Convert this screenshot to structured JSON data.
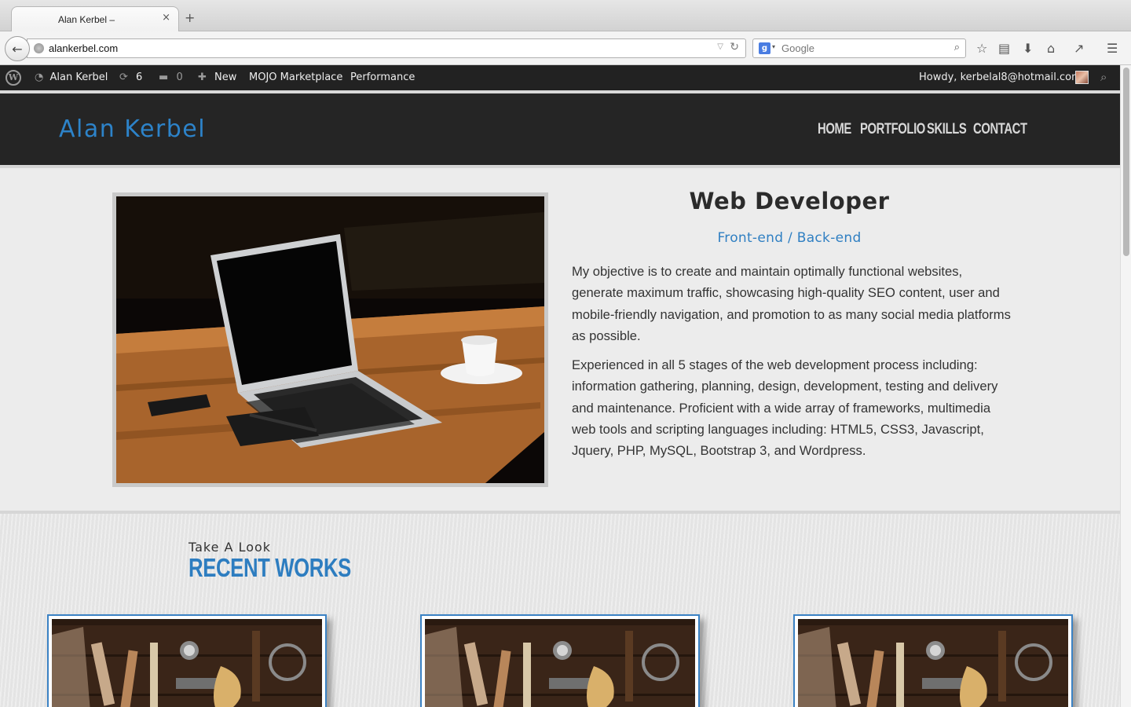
{
  "browser": {
    "tab_title": "Alan Kerbel –",
    "tab_close": "×",
    "new_tab": "+",
    "url": "alankerbel.com",
    "search_placeholder": "Google",
    "search_engine_badge": "g"
  },
  "admin_bar": {
    "site_name": "Alan Kerbel",
    "updates_count": "6",
    "comments_count": "0",
    "new_label": "New",
    "mojo_label": "MOJO Marketplace",
    "performance_label": "Performance",
    "greeting": "Howdy, kerbelal8@hotmail.com"
  },
  "site": {
    "title": "Alan Kerbel",
    "menu": [
      {
        "label": "HOME"
      },
      {
        "label": "PORTFOLIO"
      },
      {
        "label": "SKILLS"
      },
      {
        "label": "CONTACT"
      }
    ]
  },
  "about": {
    "title": "Web Developer",
    "subtitle": "Front-end / Back-end",
    "paragraph1": "My objective is to create and maintain optimally functional websites, generate maximum traffic, showcasing high-quality SEO content, user and mobile-friendly navigation, and promotion to as many social media platforms as possible.",
    "paragraph2": "Experienced in all 5 stages of the web development process including: information gathering, planning, design, development, testing and delivery and maintenance. Proficient with a wide array of frameworks, multimedia web tools and scripting languages including: HTML5, CSS3, Javascript, Jquery, PHP, MySQL, Bootstrap 3, and Wordpress."
  },
  "works": {
    "kicker": "Take A Look",
    "title": "RECENT WORKS",
    "cards": [
      {
        "image": "tools-on-wood"
      },
      {
        "image": "tools-on-wood"
      },
      {
        "image": "tools-on-wood"
      }
    ]
  },
  "colors": {
    "accent": "#2d83c9",
    "header_bg": "#252525",
    "admin_bar_bg": "#222222",
    "page_bg": "#ececec"
  }
}
